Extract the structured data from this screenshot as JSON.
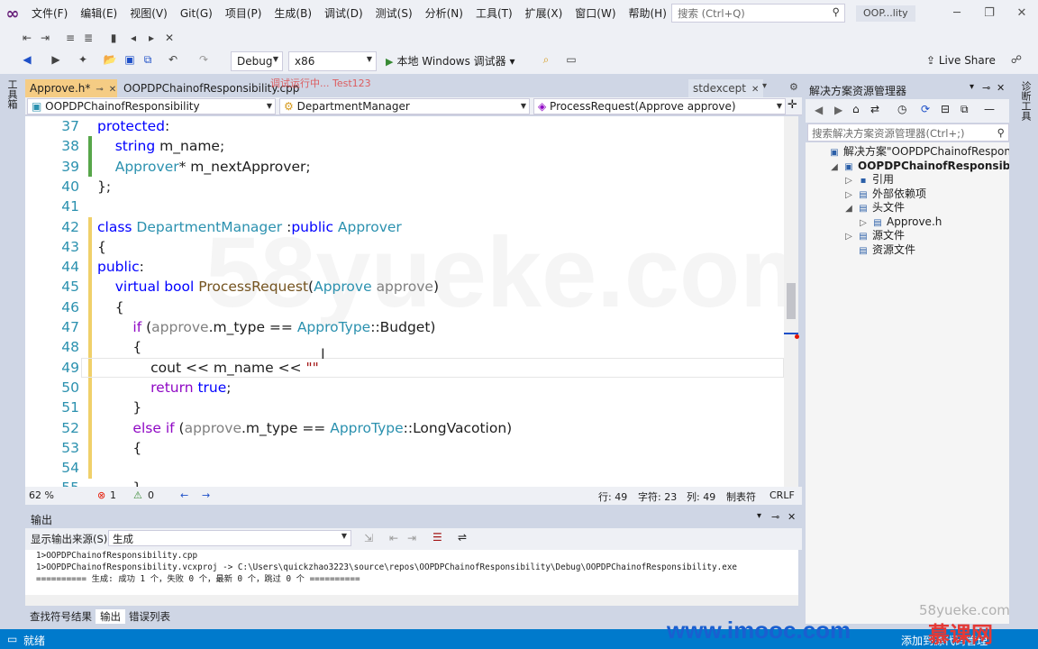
{
  "menubar": {
    "items": [
      "文件(F)",
      "编辑(E)",
      "视图(V)",
      "Git(G)",
      "项目(P)",
      "生成(B)",
      "调试(D)",
      "测试(S)",
      "分析(N)",
      "工具(T)",
      "扩展(X)",
      "窗口(W)",
      "帮助(H)"
    ],
    "search_placeholder": "搜索 (Ctrl+Q)",
    "solution_badge": "OOP...lity"
  },
  "toolbar": {
    "config": "Debug",
    "platform": "x86",
    "run_label": "本地 Windows 调试器",
    "live_share": "Live Share"
  },
  "left_strip": "工具箱",
  "right_strip": "诊断工具",
  "tabs": [
    {
      "label": "Approve.h*"
    },
    {
      "label": "OOPDPChainofResponsibility.cpp"
    },
    {
      "label": "stdexcept"
    }
  ],
  "red_overlay": "调试运行中... Test123",
  "nav": {
    "project": "OOPDPChainofResponsibility",
    "class": "DepartmentManager",
    "method": "ProcessRequest(Approve approve)"
  },
  "code_lines": [
    {
      "n": "37",
      "html": "<span class=\"kw\">protected</span>:"
    },
    {
      "n": "38",
      "html": "    <span class=\"kw\">string</span> m_name;"
    },
    {
      "n": "39",
      "html": "    <span class=\"ty\">Approver</span>* m_nextApprover;"
    },
    {
      "n": "40",
      "html": "};"
    },
    {
      "n": "41",
      "html": ""
    },
    {
      "n": "42",
      "html": "<span class=\"kw\">class</span> <span class=\"ty\">DepartmentManager</span> :<span class=\"kw\">public</span> <span class=\"ty\">Approver</span>"
    },
    {
      "n": "43",
      "html": "{"
    },
    {
      "n": "44",
      "html": "<span class=\"kw\">public</span>:"
    },
    {
      "n": "45",
      "html": "    <span class=\"kw\">virtual</span> <span class=\"kw\">bool</span> <span class=\"fn\">ProcessRequest</span>(<span class=\"ty\">Approve</span> <span class=\"prm\">approve</span>)"
    },
    {
      "n": "46",
      "html": "    {"
    },
    {
      "n": "47",
      "html": "        <span class=\"ctl\">if</span> (<span class=\"prm\">approve</span>.m_type == <span class=\"ty\">ApproType</span>::Budget)"
    },
    {
      "n": "48",
      "html": "        {"
    },
    {
      "n": "49",
      "html": "            cout &lt;&lt; m_name &lt;&lt; <span class=\"str\">\"\"</span>"
    },
    {
      "n": "50",
      "html": "            <span class=\"ctl\">return</span> <span class=\"kw\">true</span>;"
    },
    {
      "n": "51",
      "html": "        }"
    },
    {
      "n": "52",
      "html": "        <span class=\"ctl\">else</span> <span class=\"ctl\">if</span> (<span class=\"prm\">approve</span>.m_type == <span class=\"ty\">ApproType</span>::LongVacotion)"
    },
    {
      "n": "53",
      "html": "        {"
    },
    {
      "n": "54",
      "html": ""
    },
    {
      "n": "55",
      "html": "        }"
    }
  ],
  "editor_status": {
    "zoom": "62 %",
    "errors": "1",
    "warnings": "0",
    "line": "行: 49",
    "char": "字符: 23",
    "col": "列: 49",
    "tabs": "制表符",
    "eol": "CRLF"
  },
  "output": {
    "title": "输出",
    "source_label": "显示输出来源(S):",
    "source_value": "生成",
    "lines": [
      "1>OOPDPChainofResponsibility.cpp",
      "1>OOPDPChainofResponsibility.vcxproj -> C:\\Users\\quickzhao3223\\source\\repos\\OOPDPChainofResponsibility\\Debug\\OOPDPChainofResponsibility.exe",
      "========== 生成: 成功 1 个，失败 0 个，最新 0 个，跳过 0 个 =========="
    ]
  },
  "bottom_tabs": [
    "查找符号结果",
    "输出",
    "错误列表"
  ],
  "solution_explorer": {
    "title": "解决方案资源管理器",
    "search_placeholder": "搜索解决方案资源管理器(Ctrl+;)",
    "tree": [
      {
        "label": "解决方案\"OOPDPChainofResponsibility",
        "indent": 0,
        "bold": false
      },
      {
        "label": "OOPDPChainofResponsibility",
        "indent": 1,
        "bold": true
      },
      {
        "label": "引用",
        "indent": 2,
        "bold": false
      },
      {
        "label": "外部依赖项",
        "indent": 2,
        "bold": false
      },
      {
        "label": "头文件",
        "indent": 2,
        "bold": false
      },
      {
        "label": "Approve.h",
        "indent": 3,
        "bold": false
      },
      {
        "label": "源文件",
        "indent": 2,
        "bold": false
      },
      {
        "label": "资源文件",
        "indent": 2,
        "bold": false
      }
    ]
  },
  "statusbar": {
    "ready": "就绪",
    "add_source": "添加到源代码管理"
  },
  "watermark": {
    "site": "www.imooc.com",
    "brand": "慕课网",
    "small": "58yueke.com",
    "big": "58yueke.com"
  },
  "colors": {
    "accent": "#007acc",
    "active_tab": "#f5cc84",
    "keyword": "#0000ff",
    "type": "#2b91af"
  }
}
